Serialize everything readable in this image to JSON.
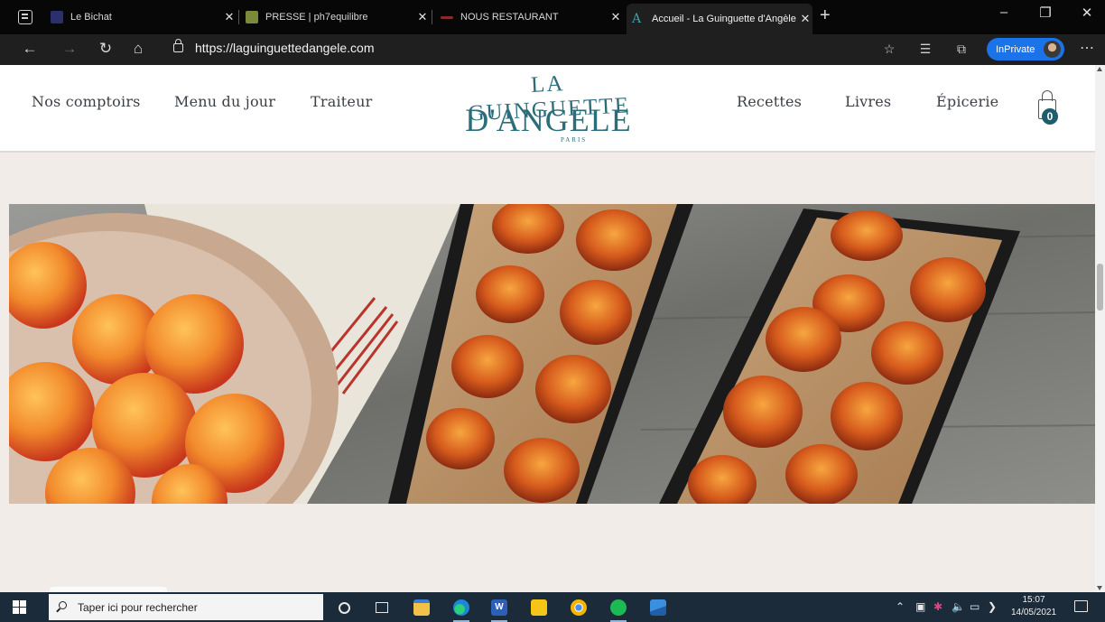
{
  "browser": {
    "tabs": [
      {
        "title": "Le Bichat",
        "favicon_color": "#2b2f6b",
        "active": false
      },
      {
        "title": "PRESSE | ph7equilibre",
        "favicon_color": "#7a8a3a",
        "active": false
      },
      {
        "title": "NOUS RESTAURANT",
        "favicon_color": "#8a2a2a",
        "active": false
      },
      {
        "title": "Accueil - La Guinguette d'Angèle",
        "favicon_color": "#3aa0b0",
        "active": true
      }
    ],
    "new_tab_label": "+",
    "close_glyph": "✕",
    "url": "https://laguinguettedangele.com",
    "inprivate_label": "InPrivate"
  },
  "site": {
    "nav_left": [
      "Nos comptoirs",
      "Menu du jour",
      "Traiteur"
    ],
    "nav_right": [
      "Recettes",
      "Livres",
      "Épicerie"
    ],
    "logo": {
      "line1": "LA GUINGUETTE",
      "line2": "D'ANGELE",
      "line3": "PARIS"
    },
    "cart_count": "0",
    "brand_color": "#2c6d7a"
  },
  "taskbar": {
    "search_placeholder": "Taper ici pour rechercher",
    "pinned_apps": [
      "cortana-icon",
      "task-view-icon",
      "file-explorer-icon",
      "edge-icon",
      "word-icon",
      "sticky-notes-icon",
      "chrome-icon",
      "spotify-icon",
      "photos-icon"
    ],
    "time": "15:07",
    "date": "14/05/2021"
  }
}
